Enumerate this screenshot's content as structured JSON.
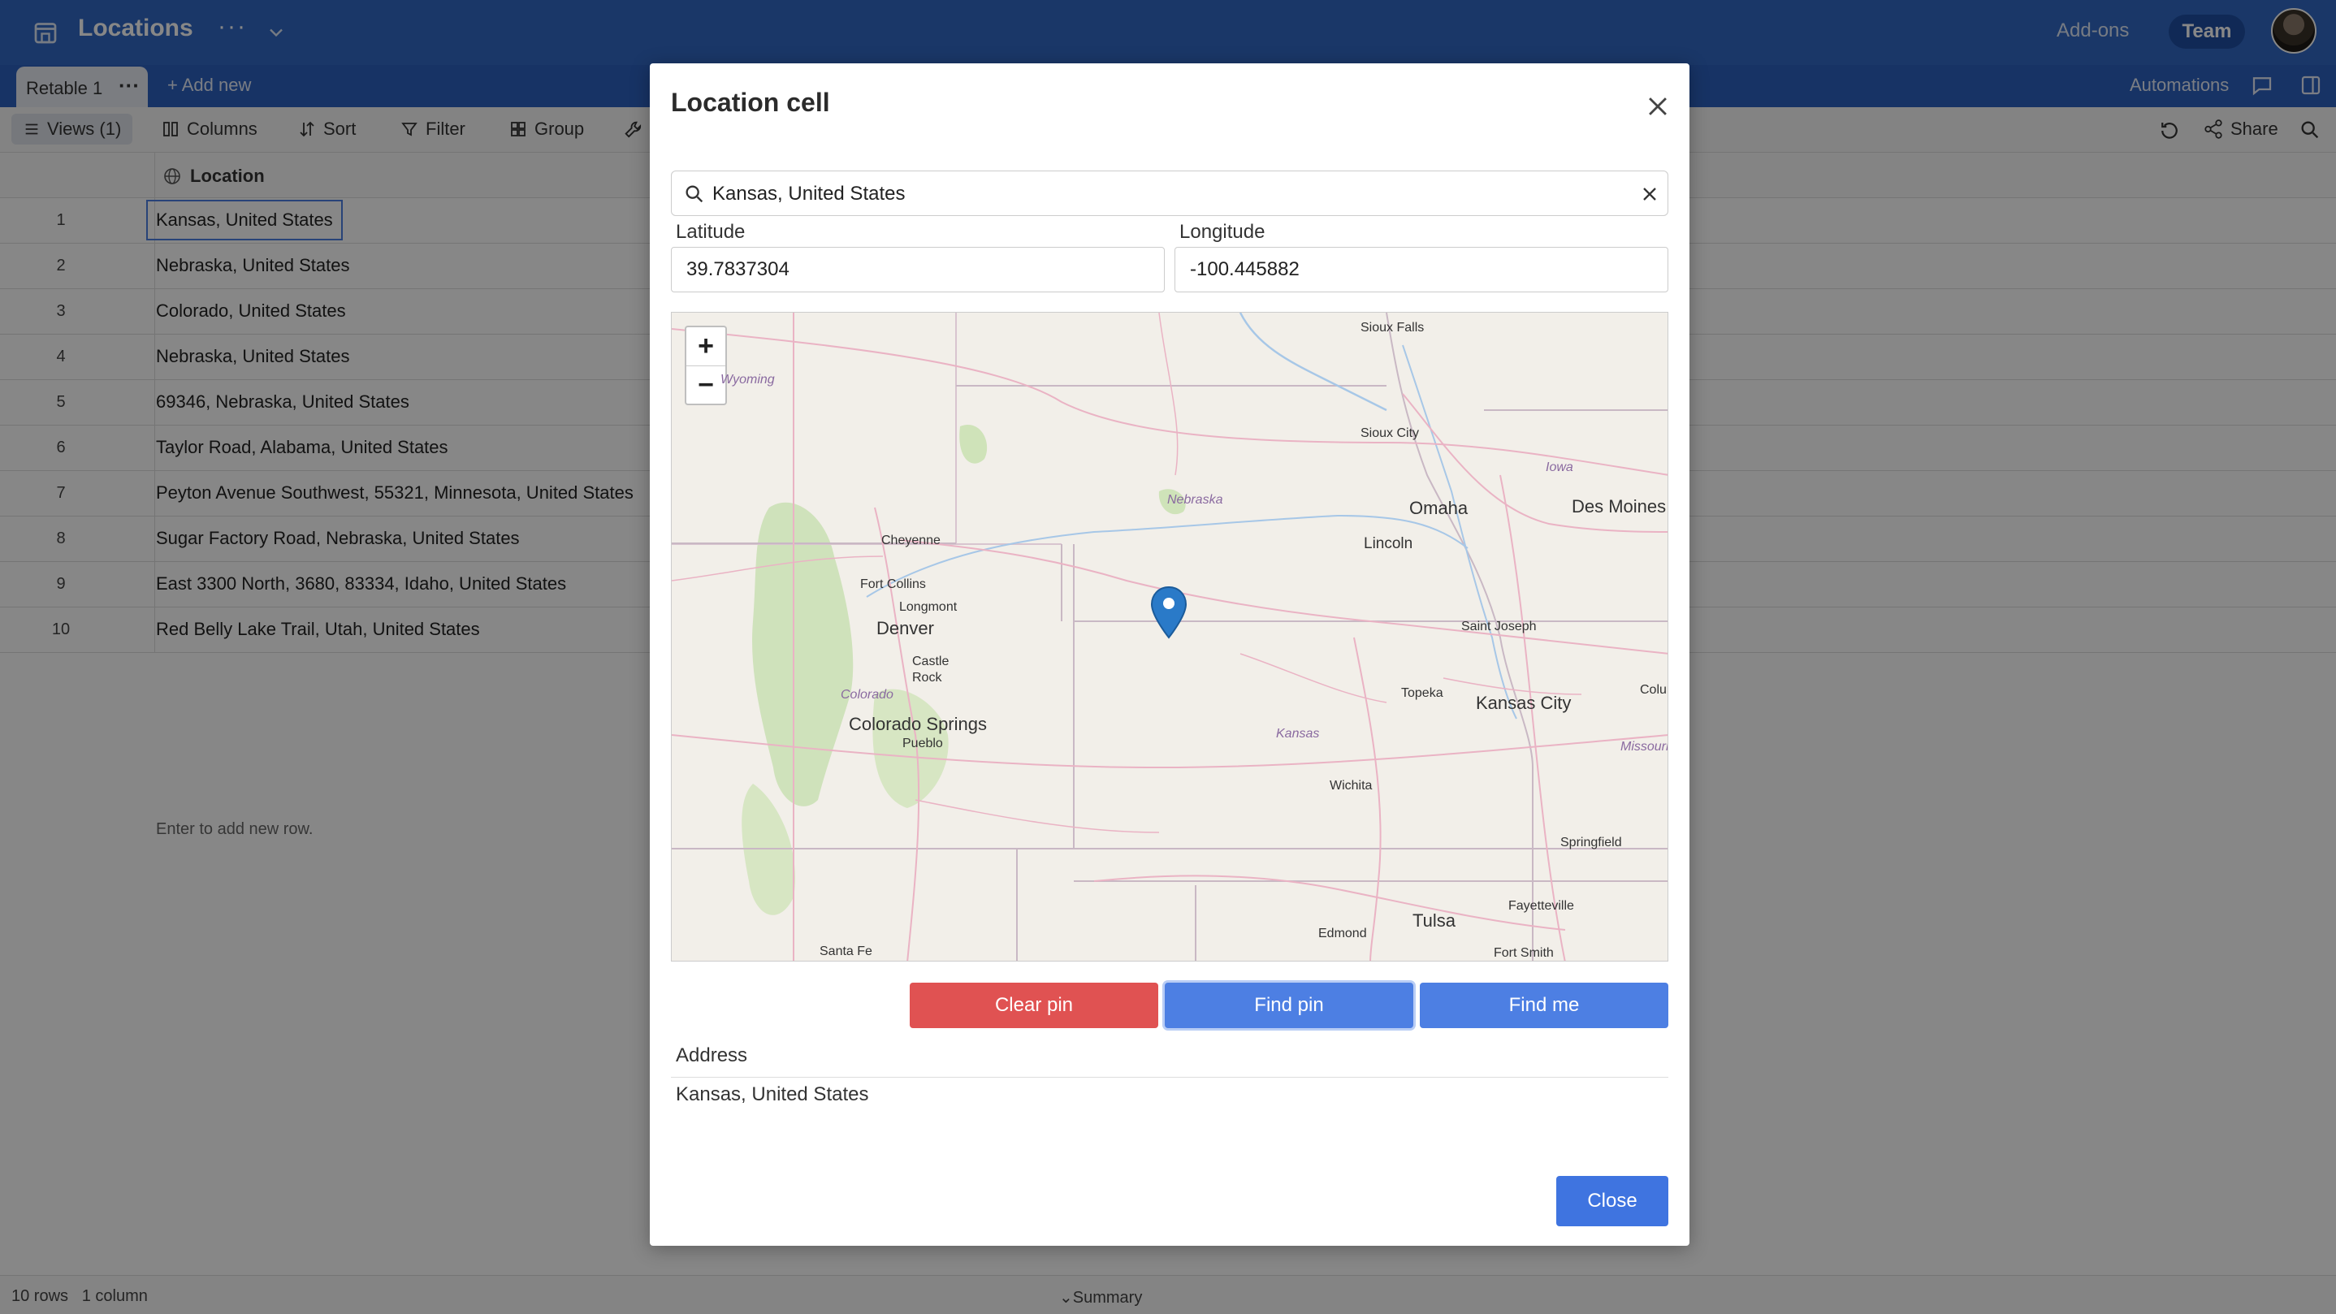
{
  "app": {
    "title": "Locations",
    "more": "···",
    "addons": "Add-ons",
    "team": "Team"
  },
  "tabs": {
    "active": "Retable 1",
    "tab_more": "···",
    "add_new": "+ Add new",
    "automations": "Automations"
  },
  "toolbar": {
    "views": "Views (1)",
    "columns": "Columns",
    "sort": "Sort",
    "filter": "Filter",
    "group": "Group",
    "share": "Share"
  },
  "grid": {
    "column": "Location",
    "rows": [
      {
        "num": "1",
        "value": "Kansas, United States"
      },
      {
        "num": "2",
        "value": "Nebraska, United States"
      },
      {
        "num": "3",
        "value": "Colorado, United States"
      },
      {
        "num": "4",
        "value": "Nebraska, United States"
      },
      {
        "num": "5",
        "value": "69346, Nebraska, United States"
      },
      {
        "num": "6",
        "value": "Taylor Road, Alabama, United States"
      },
      {
        "num": "7",
        "value": "Peyton Avenue Southwest, 55321, Minnesota, United States"
      },
      {
        "num": "8",
        "value": "Sugar Factory Road, Nebraska, United States"
      },
      {
        "num": "9",
        "value": "East 3300 North, 3680, 83334, Idaho, United States"
      },
      {
        "num": "10",
        "value": "Red Belly Lake Trail, Utah, United States"
      }
    ],
    "hint": "Enter to add new row."
  },
  "footer": {
    "rows": "10 rows",
    "columns": "1 column",
    "summary": "Summary"
  },
  "modal": {
    "title": "Location cell",
    "search_value": "Kansas, United States",
    "latitude_label": "Latitude",
    "latitude": "39.7837304",
    "longitude_label": "Longitude",
    "longitude": "-100.445882",
    "zoom_in": "+",
    "zoom_out": "−",
    "clear_pin": "Clear pin",
    "find_pin": "Find pin",
    "find_me": "Find me",
    "address_label": "Address",
    "address": "Kansas, United States",
    "close": "Close"
  },
  "map_labels": {
    "sioux_falls": "Sioux Falls",
    "wyoming": "Wyoming",
    "sioux_city": "Sioux City",
    "iowa": "Iowa",
    "nebraska": "Nebraska",
    "omaha": "Omaha",
    "des_moines": "Des Moines",
    "cheyenne": "Cheyenne",
    "lincoln": "Lincoln",
    "fort_collins": "Fort Collins",
    "longmont": "Longmont",
    "denver": "Denver",
    "saint_joseph": "Saint Joseph",
    "castle_rock": "Castle Rock",
    "topeka": "Topeka",
    "columbia": "Columb",
    "kansas_city": "Kansas City",
    "colorado": "Colorado",
    "colorado_springs": "Colorado Springs",
    "kansas": "Kansas",
    "missouri": "Missouri",
    "pueblo": "Pueblo",
    "wichita": "Wichita",
    "springfield": "Springfield",
    "fayetteville": "Fayetteville",
    "edmond": "Edmond",
    "tulsa": "Tulsa",
    "santa_fe": "Santa Fe",
    "fort_smith": "Fort Smith"
  },
  "colors": {
    "brand": "#3168c4",
    "danger": "#e05252",
    "primary": "#4d7fe3",
    "pin": "#2a7ac8"
  }
}
